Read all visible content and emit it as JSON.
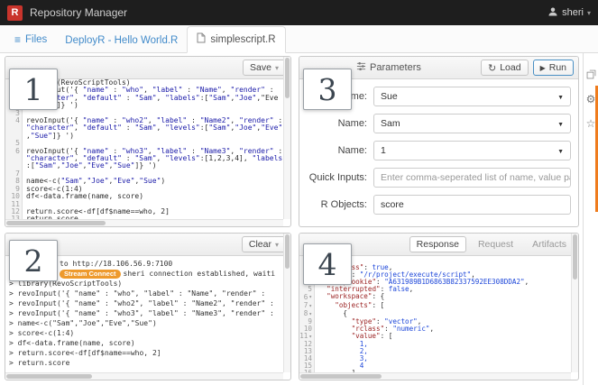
{
  "header": {
    "logo_letter": "R",
    "title": "Repository Manager",
    "user": "sheri"
  },
  "tabs": {
    "files": "Files",
    "hello_world": "DeployR - Hello World.R",
    "simplescript": "simplescript.R"
  },
  "editor": {
    "save_label": "Save",
    "rows": [
      {
        "n": "1",
        "text": "library(RevoScriptTools)"
      },
      {
        "n": "2",
        "text": "revoInput('{ \"name\" : \"who\", \"label\" : \"Name\", \"render\" :"
      },
      {
        "n": "",
        "text": "\"character\", \"default\" : \"Sam\", \"labels\":[\"Sam\",\"Joe\",\"Eve"
      },
      {
        "n": "",
        "text": "\",\"Sue\"]} ')"
      },
      {
        "n": "3",
        "text": ""
      },
      {
        "n": "4",
        "text": "revoInput('{ \"name\" : \"who2\", \"label\" : \"Name2\", \"render\" :"
      },
      {
        "n": "",
        "text": "\"character\", \"default\" : \"Sam\", \"levels\":[\"Sam\",\"Joe\",\"Eve\""
      },
      {
        "n": "",
        "text": ",\"Sue\"]} ')"
      },
      {
        "n": "5",
        "text": ""
      },
      {
        "n": "6",
        "text": "revoInput('{ \"name\" : \"who3\", \"label\" : \"Name3\", \"render\" :"
      },
      {
        "n": "",
        "text": "\"character\", \"default\" : \"Sam\", \"levels\":[1,2,3,4], \"labels\""
      },
      {
        "n": "",
        "text": ":[\"Sam\",\"Joe\",\"Eve\",\"Sue\"]} ')"
      },
      {
        "n": "7",
        "text": ""
      },
      {
        "n": "8",
        "text": "name<-c(\"Sam\",\"Joe\",\"Eve\",\"Sue\")"
      },
      {
        "n": "9",
        "text": "score<-c(1:4)"
      },
      {
        "n": "10",
        "text": "df<-data.frame(name, score)"
      },
      {
        "n": "11",
        "text": ""
      },
      {
        "n": "12",
        "text": "return.score<-df[df$name==who, 2]"
      },
      {
        "n": "13",
        "text": "return.score"
      }
    ]
  },
  "console": {
    "clear_label": "Clear",
    "line1": "to http://18.106.56.9:7100",
    "badge": "Stream Connect",
    "line2": "sheri connection established, waiti",
    "rows": [
      {
        "text": "> library(RevoScriptTools)"
      },
      {
        "text": "> revoInput('{ \"name\" : \"who\", \"label\" : \"Name\", \"render\" :"
      },
      {
        "text": "> revoInput('{ \"name\" : \"who2\", \"label\" : \"Name2\", \"render\" :"
      },
      {
        "text": "> revoInput('{ \"name\" : \"who3\", \"label\" : \"Name3\", \"render\" :"
      },
      {
        "text": "> name<-c(\"Sam\",\"Joe\",\"Eve\",\"Sue\")"
      },
      {
        "text": "> score<-c(1:4)"
      },
      {
        "text": "> df<-data.frame(name, score)"
      },
      {
        "text": "> return.score<-df[df$name==who, 2]"
      },
      {
        "text": "> return.score"
      }
    ]
  },
  "parameters": {
    "title": "Parameters",
    "load_label": "Load",
    "run_label": "Run",
    "fields": [
      {
        "label": "Name:",
        "value": "Sue"
      },
      {
        "label": "Name:",
        "value": "Sam"
      },
      {
        "label": "Name:",
        "value": "1"
      },
      {
        "label": "Quick Inputs:",
        "value": "",
        "placeholder": "Enter comma-seperated list of name, value pairs (i."
      },
      {
        "label": "R Objects:",
        "value": "score"
      }
    ]
  },
  "response": {
    "tabs": [
      "Response",
      "Request",
      "Artifacts"
    ],
    "active_tab": "Response",
    "rows": [
      {
        "n": "1",
        "fold": true,
        "text": "{"
      },
      {
        "n": "2",
        "text": "  \"success\": true,"
      },
      {
        "n": "3",
        "text": "  \"call\": \"/r/project/execute/script\","
      },
      {
        "n": "4",
        "text": "  \"httpcookie\": \"A631989B1D6863B82337592EE308DDA2\","
      },
      {
        "n": "5",
        "text": "  \"interrupted\": false,"
      },
      {
        "n": "6",
        "fold": true,
        "text": "  \"workspace\": {"
      },
      {
        "n": "7",
        "fold": true,
        "text": "    \"objects\": ["
      },
      {
        "n": "8",
        "fold": true,
        "text": "      {"
      },
      {
        "n": "9",
        "text": "        \"type\": \"vector\","
      },
      {
        "n": "10",
        "text": "        \"rclass\": \"numeric\","
      },
      {
        "n": "11",
        "fold": true,
        "text": "        \"value\": ["
      },
      {
        "n": "12",
        "text": "          1,"
      },
      {
        "n": "13",
        "text": "          2,"
      },
      {
        "n": "14",
        "text": "          3,"
      },
      {
        "n": "15",
        "text": "          4"
      },
      {
        "n": "16",
        "text": "        ],"
      }
    ]
  },
  "annotations": [
    "1",
    "2",
    "3",
    "4"
  ]
}
